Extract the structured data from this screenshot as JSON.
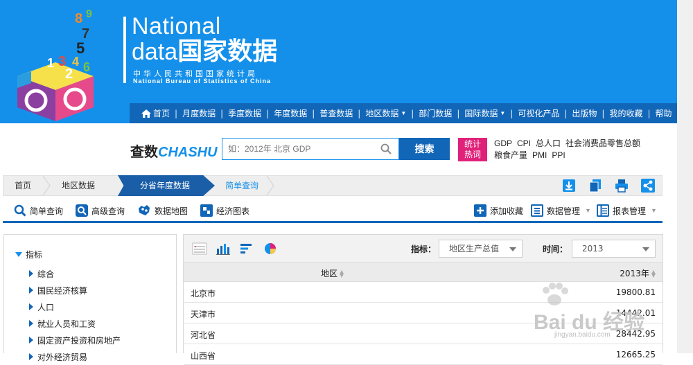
{
  "brand": {
    "national": "National",
    "data_en": "data",
    "data_cn": "国家数据",
    "org_cn": "中华人民共和国国家统计局",
    "org_en": "National Bureau of Statistics of China",
    "logo_digits": [
      "8",
      "9",
      "7",
      "5",
      "1",
      "3",
      "4",
      "6",
      "2"
    ],
    "colors": {
      "primary": "#1590ea",
      "nav": "#1166b8",
      "accent": "#e0217a"
    }
  },
  "nav": {
    "items": [
      {
        "label": "首页",
        "icon": "home-icon"
      },
      {
        "label": "月度数据"
      },
      {
        "label": "季度数据"
      },
      {
        "label": "年度数据"
      },
      {
        "label": "普查数据"
      },
      {
        "label": "地区数据",
        "dropdown": true
      },
      {
        "label": "部门数据"
      },
      {
        "label": "国际数据",
        "dropdown": true
      },
      {
        "label": "可视化产品"
      },
      {
        "label": "出版物"
      },
      {
        "label": "我的收藏"
      },
      {
        "label": "帮助"
      }
    ]
  },
  "search": {
    "logo_cn": "查数",
    "logo_en": "CHASHU",
    "placeholder": "如：2012年 北京 GDP",
    "button": "搜索",
    "hot_badge_line1": "统计",
    "hot_badge_line2": "热词",
    "hot_words": [
      "GDP",
      "CPI",
      "总人口",
      "社会消费品零售总额",
      "粮食产量",
      "PMI",
      "PPI"
    ]
  },
  "breadcrumb": {
    "home": "首页",
    "region": "地区数据",
    "active": "分省年度数据",
    "last": "简单查询",
    "tools": [
      "download-icon",
      "copy-icon",
      "print-icon",
      "share-icon"
    ]
  },
  "toolbar": {
    "simple_query": "简单查询",
    "advanced_query": "高级查询",
    "data_map": "数据地图",
    "econ_chart": "经济图表",
    "add_favorite": "添加收藏",
    "data_manage": "数据管理",
    "report_manage": "报表管理"
  },
  "tree": {
    "root": "指标",
    "items": [
      "综合",
      "国民经济核算",
      "人口",
      "就业人员和工资",
      "固定资产投资和房地产",
      "对外经济贸易"
    ]
  },
  "table": {
    "indicator_label": "指标：",
    "indicator_value": "地区生产总值",
    "time_label": "时间：",
    "time_value": "2013",
    "col_region": "地区",
    "col_year": "2013年",
    "rows": [
      {
        "region": "北京市",
        "value": "19800.81"
      },
      {
        "region": "天津市",
        "value": "14442.01"
      },
      {
        "region": "河北省",
        "value": "28442.95"
      },
      {
        "region": "山西省",
        "value": "12665.25"
      }
    ]
  },
  "watermark": {
    "text": "Bai du 经验",
    "sub": "jingyan.baidu.com"
  }
}
